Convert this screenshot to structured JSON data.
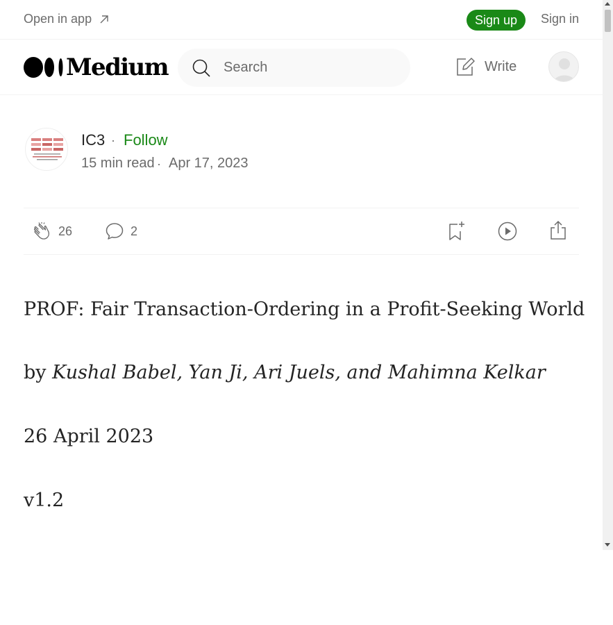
{
  "topbar": {
    "open_in_app": "Open in app",
    "sign_up": "Sign up",
    "sign_in": "Sign in"
  },
  "header": {
    "logo_text": "Medium",
    "search_placeholder": "Search",
    "write_label": "Write"
  },
  "author": {
    "name": "IC3",
    "separator": "·",
    "follow_label": "Follow",
    "read_time": "15 min read",
    "date": "Apr 17, 2023"
  },
  "actions": {
    "claps": "26",
    "responses": "2"
  },
  "article": {
    "title": "PROF: Fair Transaction-Ordering in a Profit-Seeking World",
    "by_prefix": "by ",
    "authors": "Kushal Babel, Yan Ji, Ari Juels, and Mahimna Kelkar",
    "date": "26 April 2023",
    "version": "v1.2"
  },
  "icons": {
    "external": "arrow-up-right-icon",
    "search": "search-icon",
    "write": "write-icon",
    "clap": "clap-icon",
    "comment": "comment-icon",
    "bookmark": "bookmark-add-icon",
    "play": "play-icon",
    "share": "share-icon"
  },
  "colors": {
    "brand_green": "#1a8917",
    "text": "#242424",
    "muted": "#6b6b6b"
  }
}
